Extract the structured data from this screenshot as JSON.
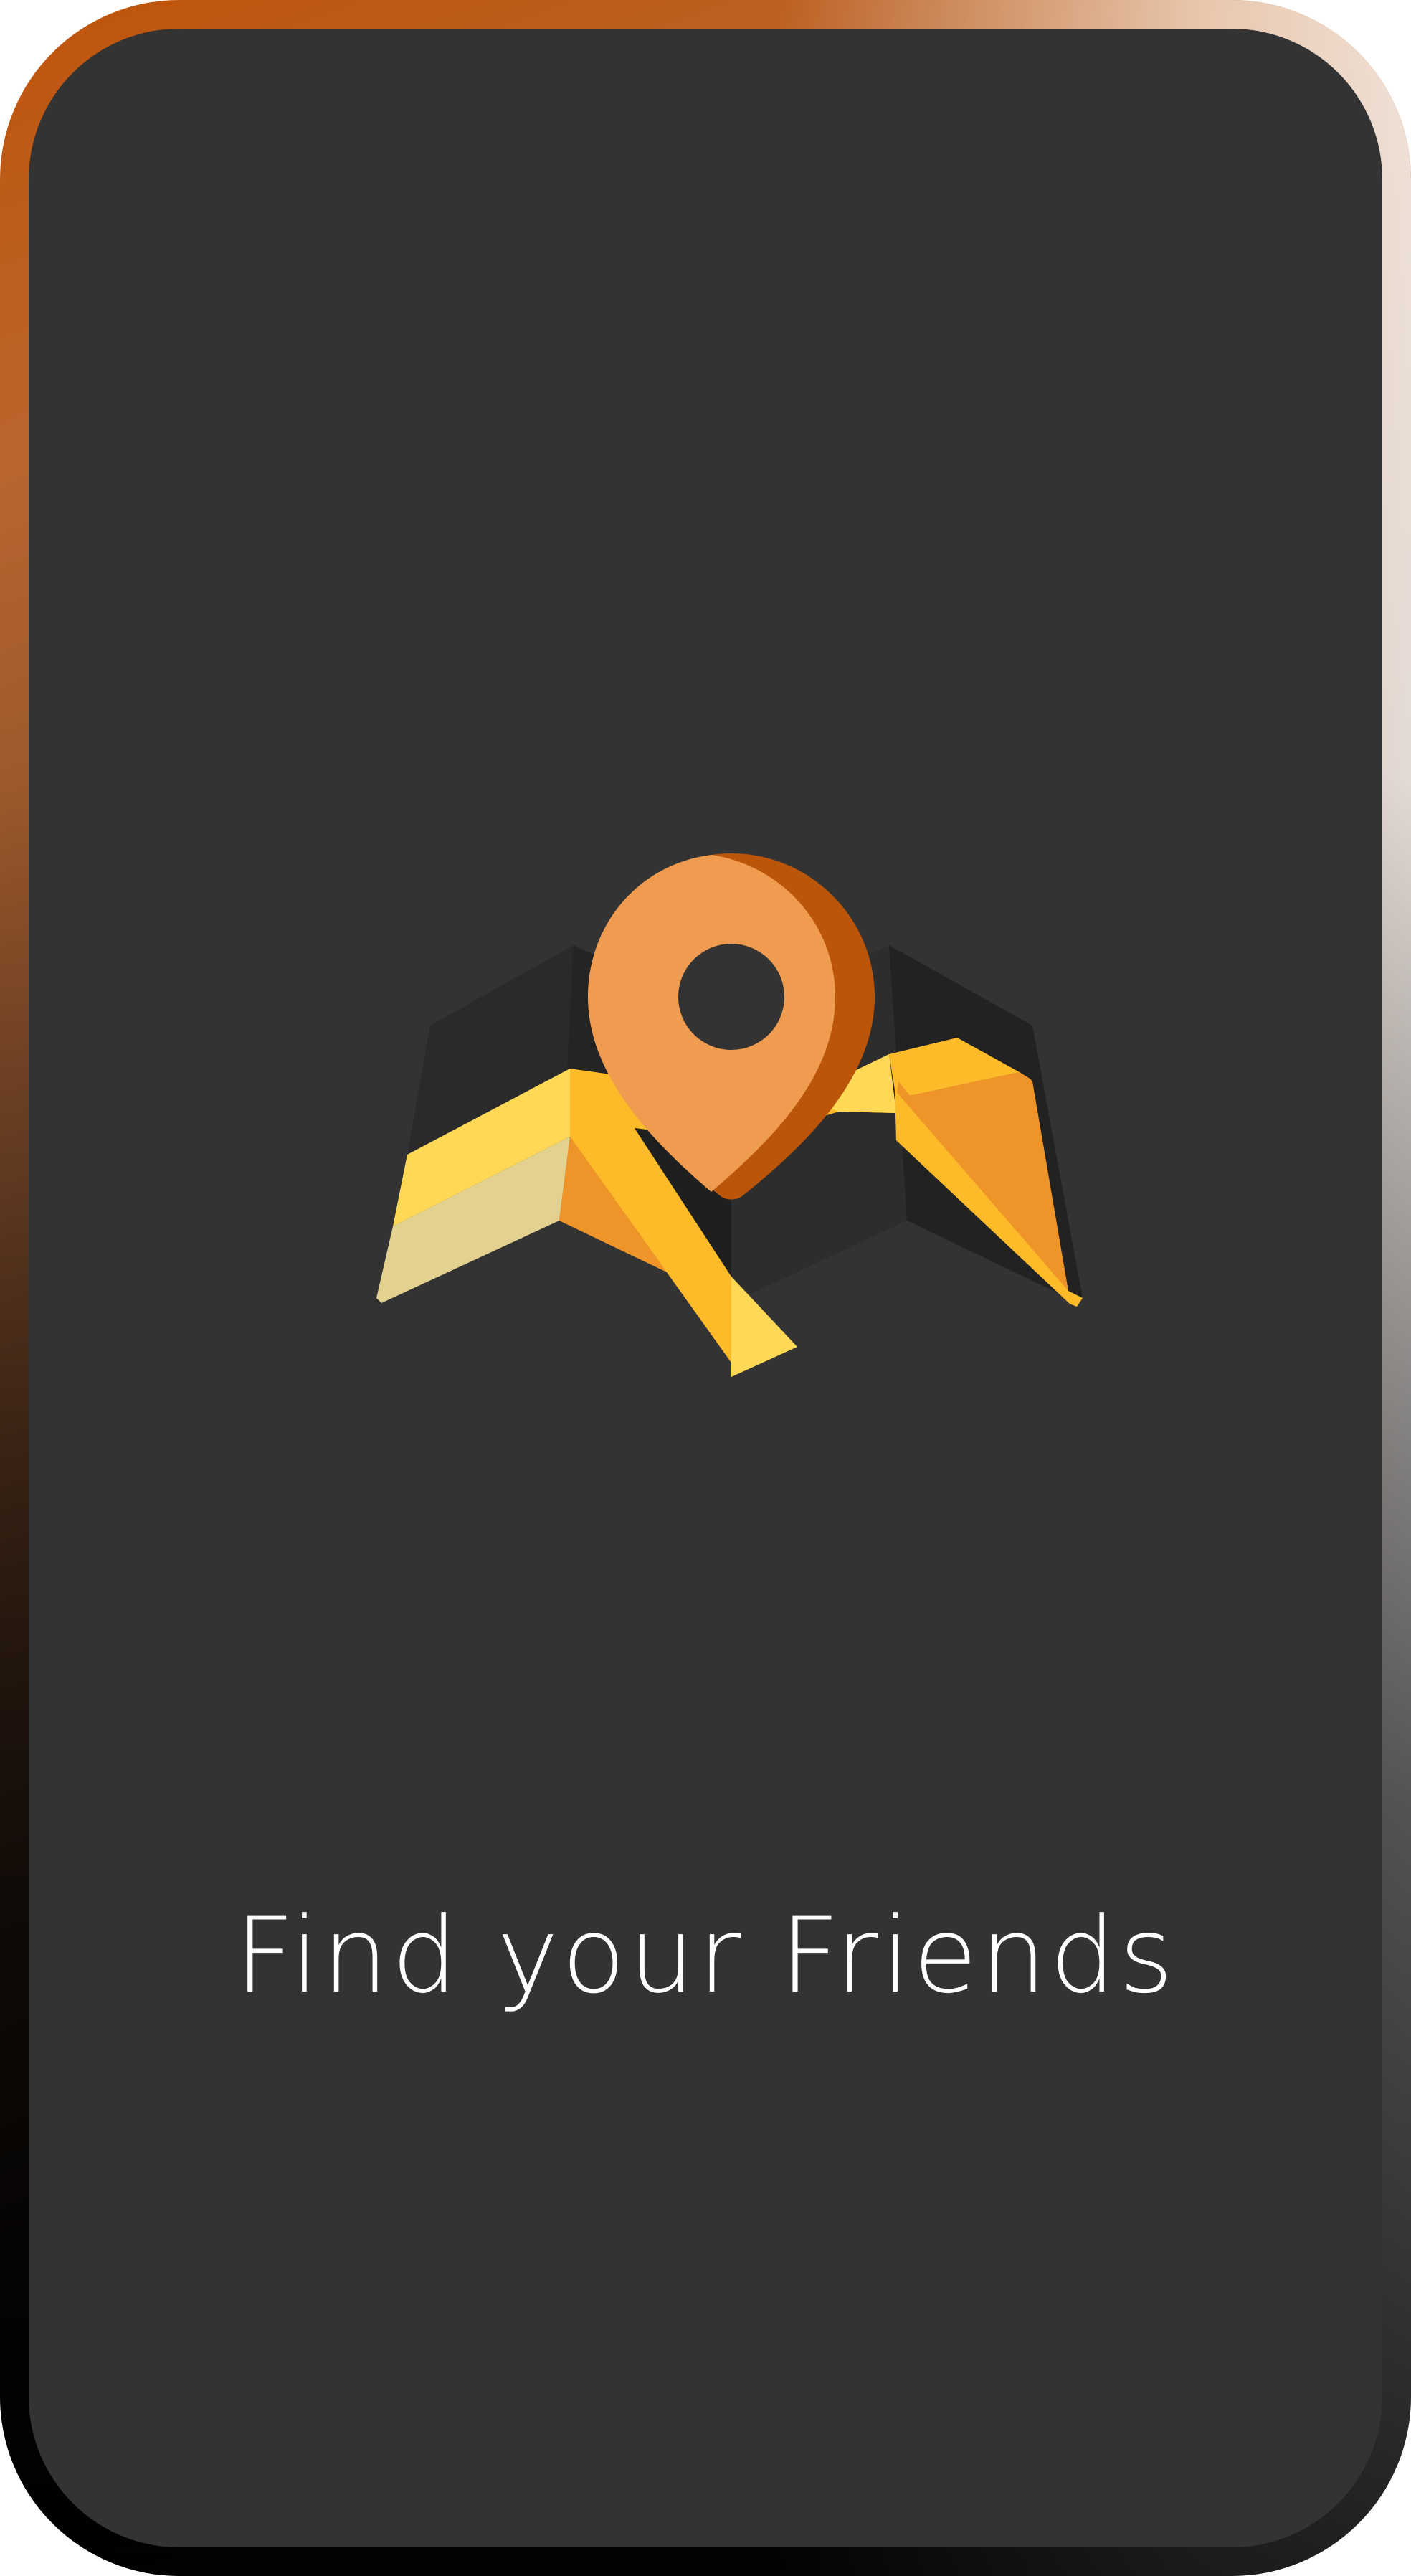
{
  "onboarding": {
    "headline": "Find your Friends"
  },
  "illustration": {
    "icon": "map-location-pin-icon"
  },
  "colors": {
    "screen_background": "#333333",
    "accent_orange": "#f09c50",
    "accent_dark_orange": "#bb5509",
    "map_yellow": "#fdbb2a",
    "map_light_yellow": "#ffd955",
    "map_beige": "#e3d190",
    "map_orange": "#ef9428",
    "map_dark": "#262626",
    "text": "#ffffff"
  }
}
